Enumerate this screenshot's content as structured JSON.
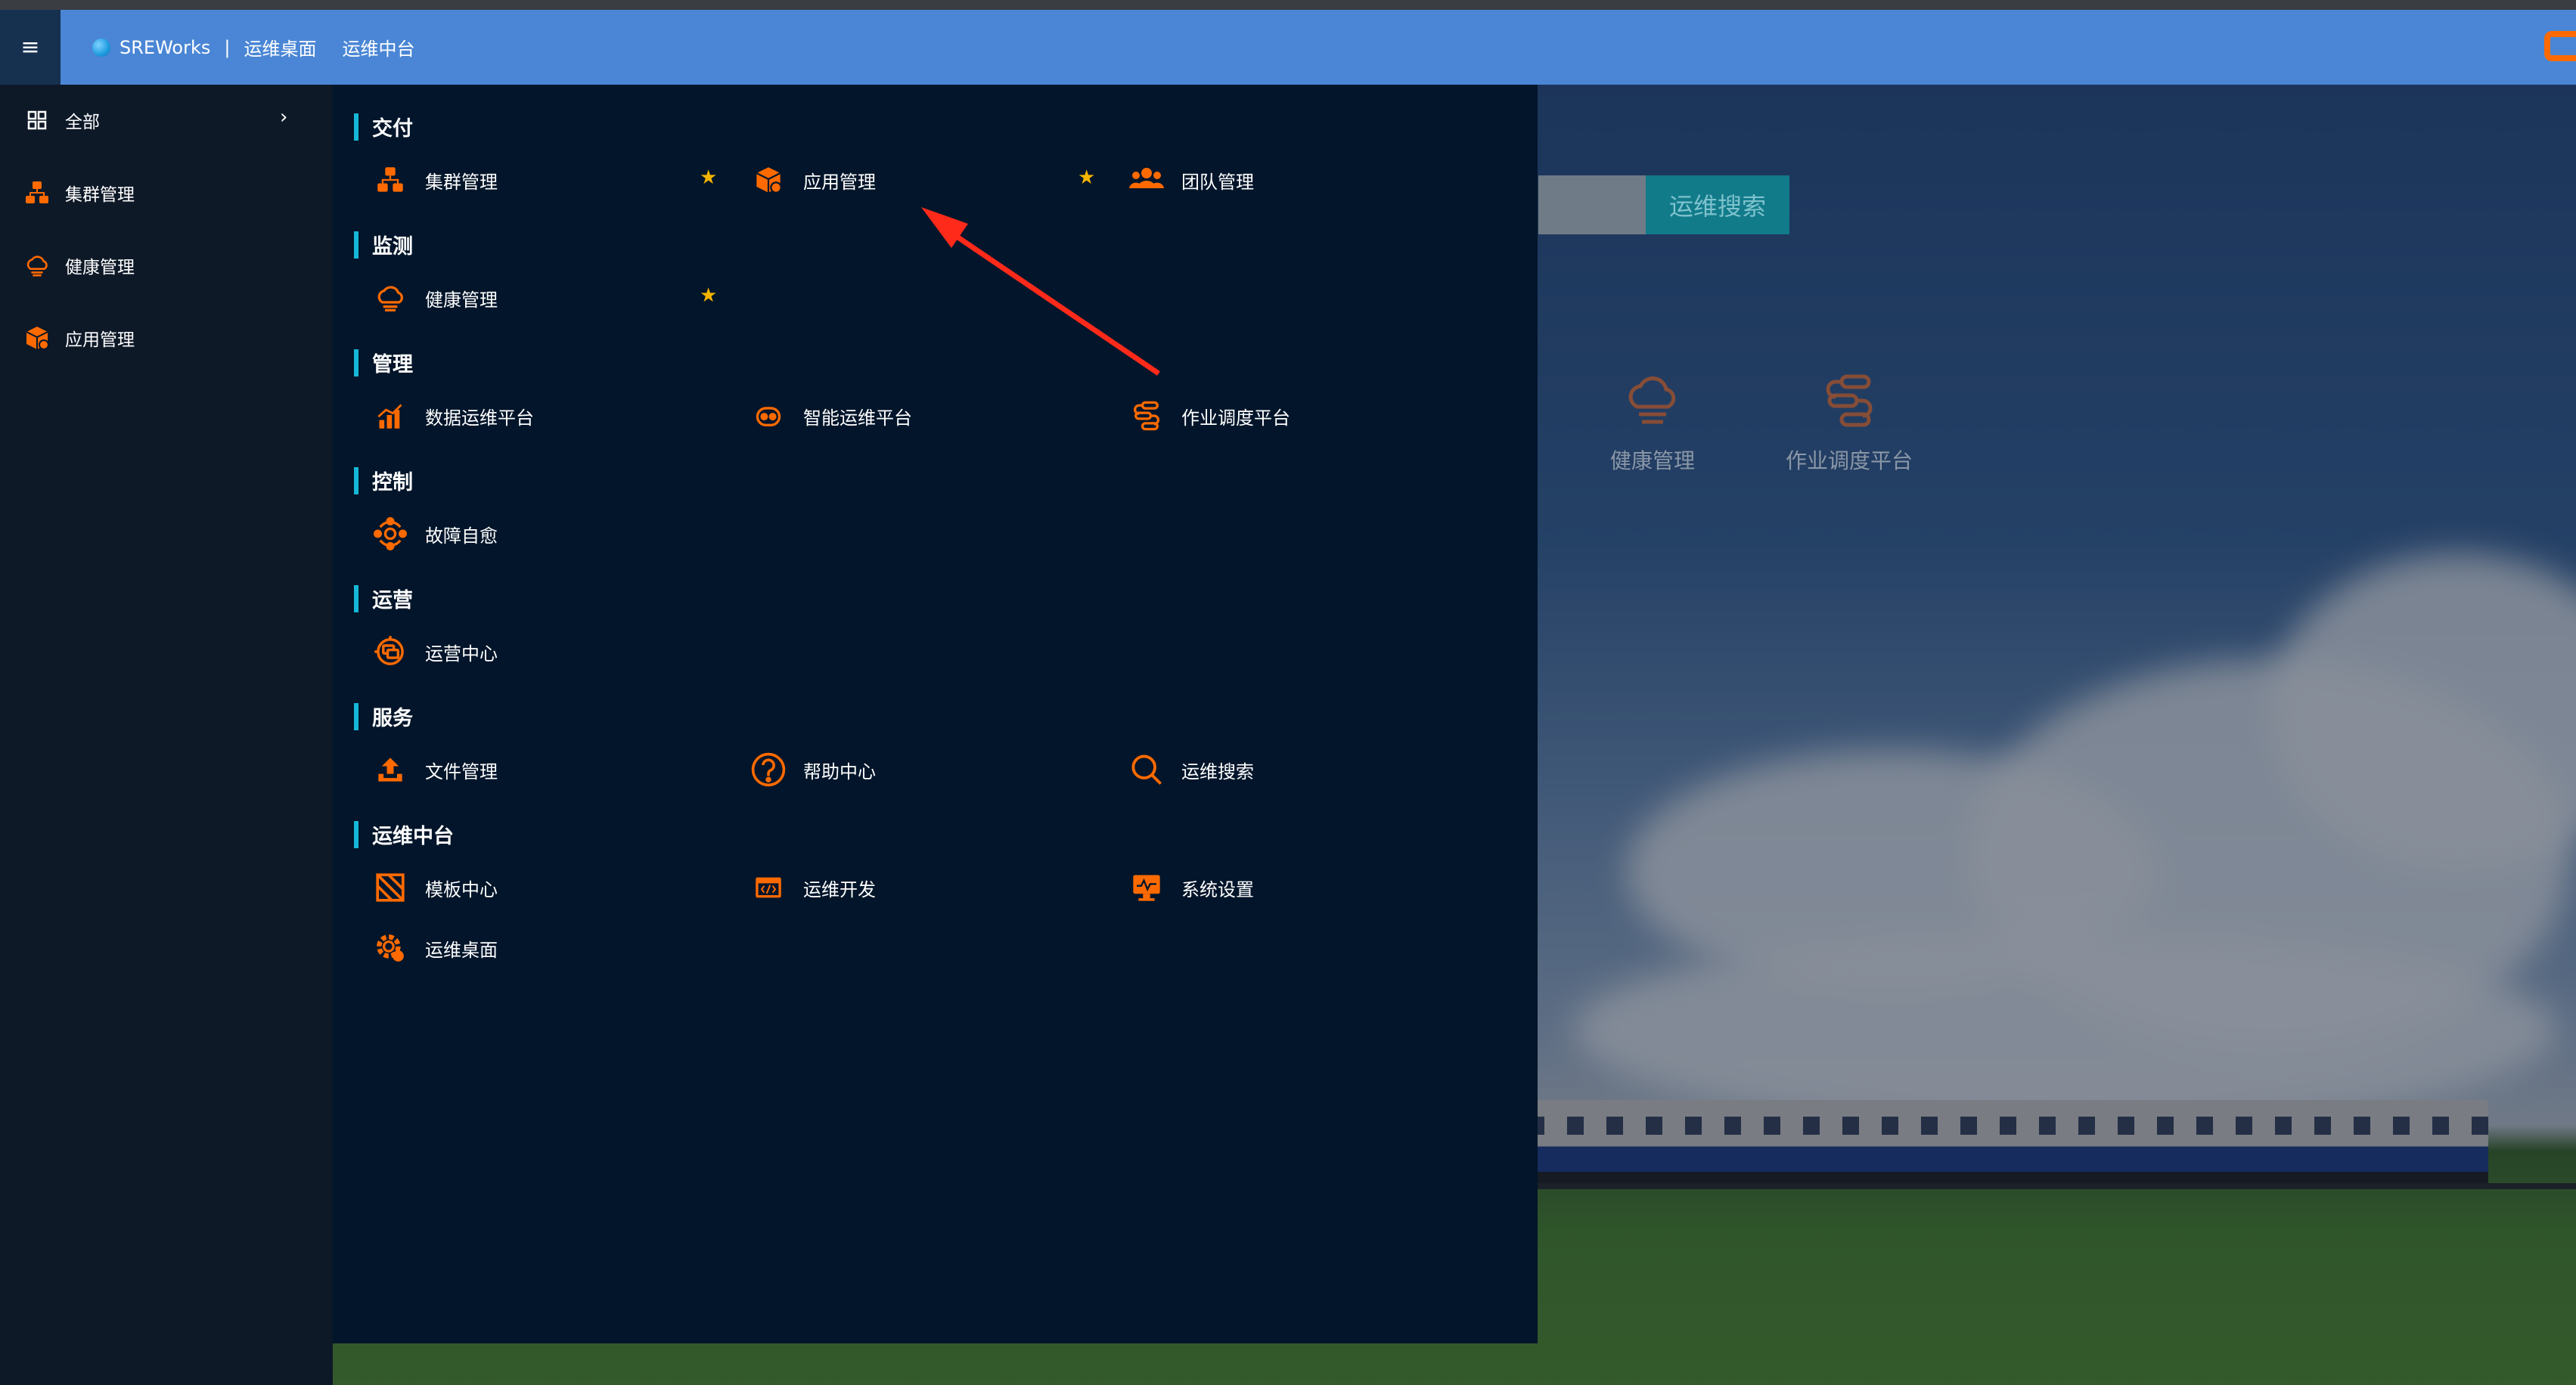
{
  "colors": {
    "accent": "#ff6a00",
    "topbar": "#4a86d5",
    "panel": "#02152a",
    "category_bar": "#16b8d8",
    "star": "#f5b400"
  },
  "topbar": {
    "brand": "SREWorks",
    "separator": "|",
    "crumb1": "运维桌面",
    "crumb2": "运维中台",
    "menu_icon": "≡"
  },
  "sidebar": {
    "all_label": "全部",
    "items": [
      {
        "label": "集群管理",
        "icon": "cluster-icon"
      },
      {
        "label": "健康管理",
        "icon": "health-cloud-icon"
      },
      {
        "label": "应用管理",
        "icon": "app-box-icon"
      }
    ]
  },
  "panel": {
    "categories": [
      {
        "title": "交付",
        "entries": [
          {
            "label": "集群管理",
            "starred": true
          },
          {
            "label": "应用管理",
            "starred": true
          },
          {
            "label": "团队管理",
            "starred": false
          }
        ]
      },
      {
        "title": "监测",
        "entries": [
          {
            "label": "健康管理",
            "starred": true
          }
        ]
      },
      {
        "title": "管理",
        "entries": [
          {
            "label": "数据运维平台"
          },
          {
            "label": "智能运维平台"
          },
          {
            "label": "作业调度平台"
          }
        ]
      },
      {
        "title": "控制",
        "entries": [
          {
            "label": "故障自愈"
          }
        ]
      },
      {
        "title": "运营",
        "entries": [
          {
            "label": "运营中心"
          }
        ]
      },
      {
        "title": "服务",
        "entries": [
          {
            "label": "文件管理"
          },
          {
            "label": "帮助中心"
          },
          {
            "label": "运维搜索"
          }
        ]
      },
      {
        "title": "运维中台",
        "entries": [
          {
            "label": "模板中心"
          },
          {
            "label": "运维开发"
          },
          {
            "label": "系统设置"
          },
          {
            "label": "运维桌面"
          }
        ]
      }
    ]
  },
  "background": {
    "search_button": "运维搜索",
    "apps": [
      {
        "label": "健康管理"
      },
      {
        "label": "作业调度平台"
      }
    ]
  }
}
